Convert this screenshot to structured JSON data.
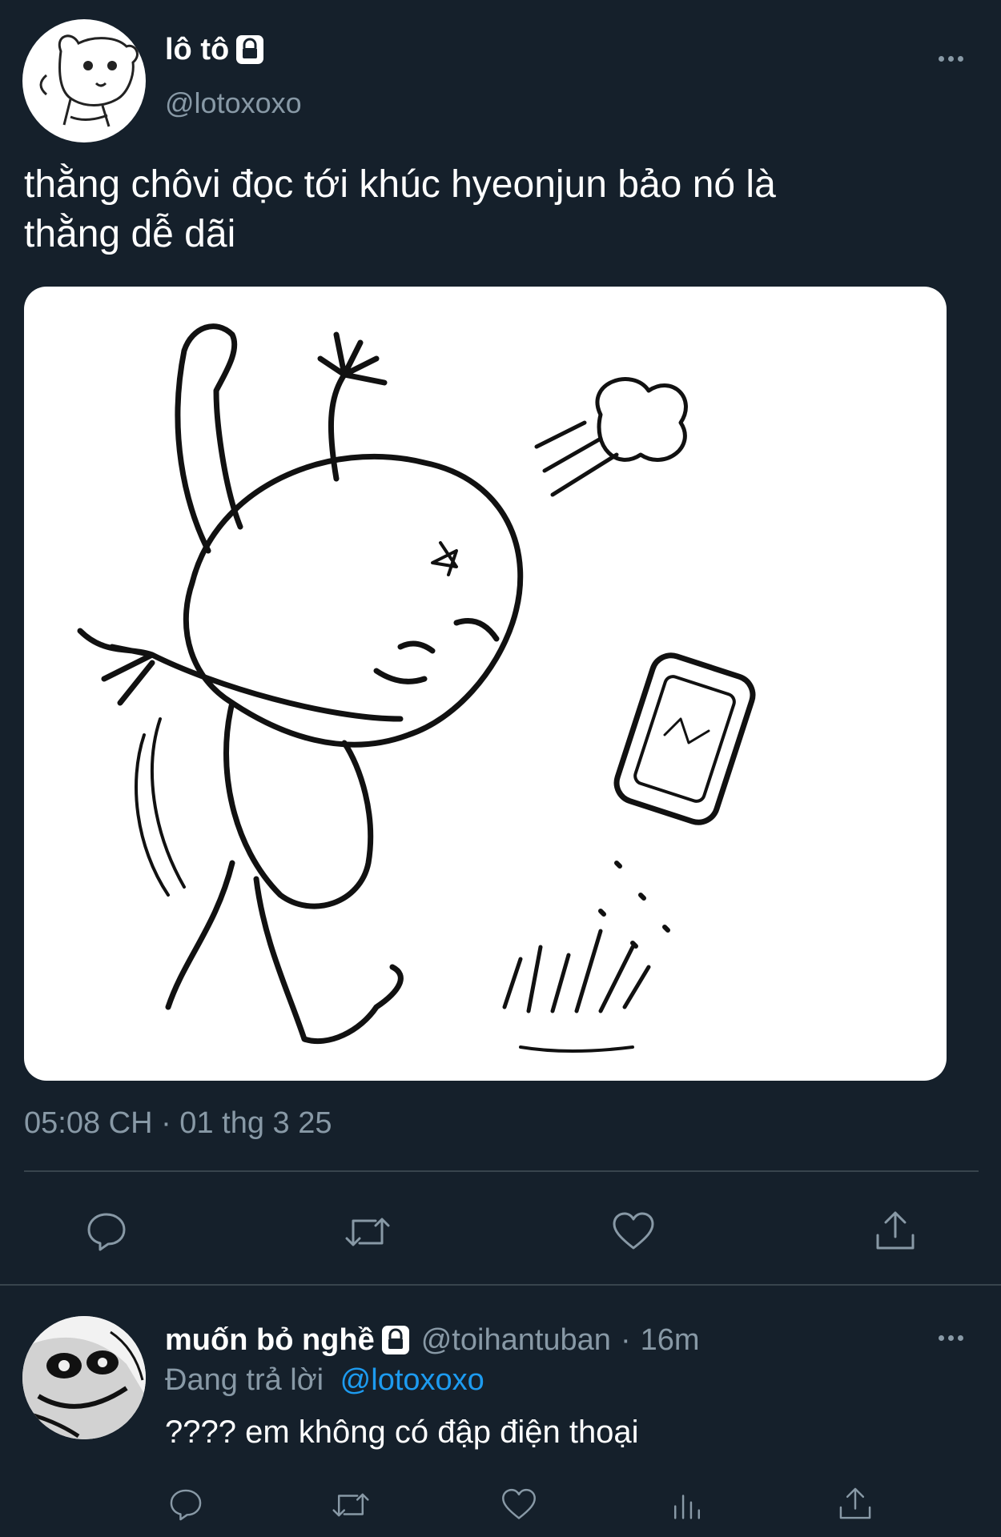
{
  "main_tweet": {
    "display_name": "lô tô",
    "handle": "@lotoxoxo",
    "text_line1": "thằng chôvi đọc tới khúc hyeonjun bảo nó là",
    "text_line2": "thằng dễ dãi",
    "timestamp": "05:08 CH · 01 thg 3 25",
    "locked": true,
    "icons": [
      "reply-icon",
      "retweet-icon",
      "like-icon",
      "share-icon",
      "more-icon",
      "lock-icon"
    ]
  },
  "reply_tweet": {
    "display_name": "muốn bỏ nghề",
    "handle": "@toihantuban",
    "separator": "·",
    "time_ago": "16m",
    "replying_prefix": "Đang trả lời",
    "replying_to": "@lotoxoxo",
    "text": "???? em không có đập điện thoại",
    "locked": true,
    "icons": [
      "reply-icon",
      "retweet-icon",
      "like-icon",
      "analytics-icon",
      "share-icon",
      "more-icon",
      "lock-icon"
    ]
  },
  "colors": {
    "background": "#15202b",
    "text": "#ffffff",
    "muted": "#8899a6",
    "link": "#1d9bf0",
    "divider": "#38444d"
  }
}
